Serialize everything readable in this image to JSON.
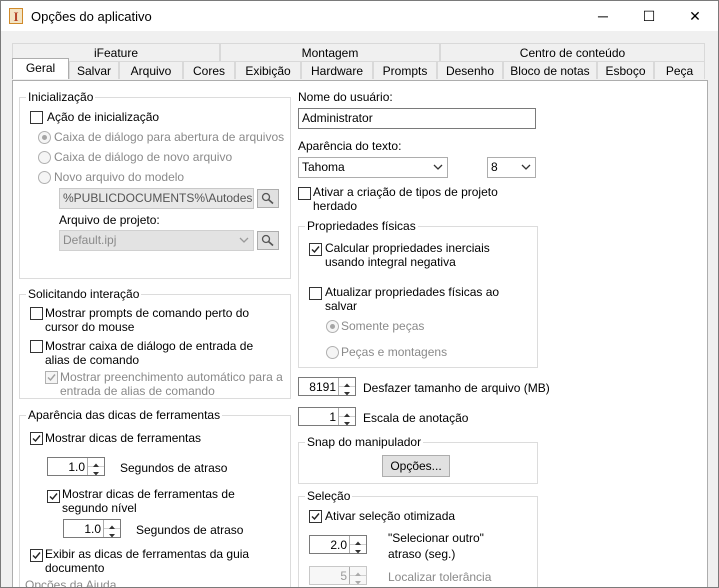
{
  "window": {
    "title": "Opções do aplicativo",
    "icon_letter": "I",
    "minimize": "─",
    "maximize": "☐",
    "close": "✕"
  },
  "tabs_top": [
    "iFeature",
    "Montagem",
    "Centro de conteúdo"
  ],
  "tabs_bottom": [
    "Geral",
    "Salvar",
    "Arquivo",
    "Cores",
    "Exibição",
    "Hardware",
    "Prompts",
    "Desenho",
    "Bloco de notas",
    "Esboço",
    "Peça"
  ],
  "active_tab": "Geral",
  "inicializacao": {
    "title": "Inicialização",
    "acao_label": "Ação de inicialização",
    "opt_abrir": "Caixa de diálogo para abertura de arquivos",
    "opt_novo": "Caixa de diálogo de novo arquivo",
    "opt_modelo": "Novo arquivo do modelo",
    "template_path": "%PUBLICDOCUMENTS%\\Autodesk\\Inv",
    "projeto_label": "Arquivo de projeto:",
    "projeto_value": "Default.ipj"
  },
  "interacao": {
    "title": "Solicitando interação",
    "prompts_label": "Mostrar prompts de comando perto do cursor do mouse",
    "alias_label": "Mostrar caixa de diálogo de entrada de alias de comando",
    "autocomplete_label": "Mostrar preenchimento automático para a entrada de alias de comando"
  },
  "dicas": {
    "title": "Aparência das dicas de ferramentas",
    "mostrar_label": "Mostrar dicas de ferramentas",
    "atraso1_value": "1.0",
    "atraso1_label": "Segundos de atraso",
    "segundo_nivel_label": "Mostrar dicas de ferramentas de segundo nível",
    "atraso2_value": "1.0",
    "atraso2_label": "Segundos de atraso",
    "guia_label": "Exibir as dicas de ferramentas da guia documento",
    "cutoff_label": "Opções da Ajuda"
  },
  "usuario": {
    "label": "Nome do usuário:",
    "value": "Administrator"
  },
  "texto": {
    "label": "Aparência do texto:",
    "font": "Tahoma",
    "size": "8"
  },
  "herdado_label": "Ativar a criação de tipos de projeto herdado",
  "fisicas": {
    "title": "Propriedades físicas",
    "inerciais_label": "Calcular propriedades inerciais usando integral negativa",
    "atualizar_label": "Atualizar propriedades físicas ao salvar",
    "opt_pecas": "Somente peças",
    "opt_montagens": "Peças e montagens"
  },
  "desfazer": {
    "value": "8191",
    "label": "Desfazer tamanho de arquivo (MB)"
  },
  "escala": {
    "value": "1",
    "label": "Escala de anotação"
  },
  "snap": {
    "title": "Snap do manipulador",
    "button": "Opções..."
  },
  "selecao": {
    "title": "Seleção",
    "otimizada_label": "Ativar seleção otimizada",
    "outro_value": "2.0",
    "outro_label_1": "\"Selecionar outro\"",
    "outro_label_2": "atraso (seg.)",
    "tolerancia_value": "5",
    "tolerancia_label": "Localizar tolerância"
  }
}
